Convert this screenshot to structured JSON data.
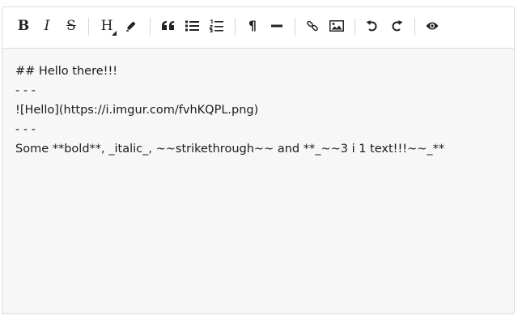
{
  "toolbar": {
    "buttons": [
      {
        "name": "bold-button",
        "icon": "bold-icon",
        "glyph": "B"
      },
      {
        "name": "italic-button",
        "icon": "italic-icon",
        "glyph": "I"
      },
      {
        "name": "strikethrough-button",
        "icon": "strikethrough-icon",
        "glyph": "S"
      },
      {
        "name": "heading-button",
        "icon": "heading-icon",
        "glyph": "H"
      },
      {
        "name": "highlight-button",
        "icon": "pen-icon"
      },
      {
        "name": "quote-button",
        "icon": "quote-icon"
      },
      {
        "name": "unordered-list-button",
        "icon": "bullet-list-icon"
      },
      {
        "name": "ordered-list-button",
        "icon": "numbered-list-icon"
      },
      {
        "name": "paragraph-button",
        "icon": "pilcrow-icon",
        "glyph": "¶"
      },
      {
        "name": "horizontal-rule-button",
        "icon": "horizontal-rule-icon"
      },
      {
        "name": "link-button",
        "icon": "link-icon"
      },
      {
        "name": "image-button",
        "icon": "image-icon"
      },
      {
        "name": "undo-button",
        "icon": "undo-icon"
      },
      {
        "name": "redo-button",
        "icon": "redo-icon"
      },
      {
        "name": "preview-button",
        "icon": "eye-icon"
      }
    ]
  },
  "editor": {
    "lines": [
      "## Hello there!!!",
      "- - -",
      "![Hello](https://i.imgur.com/fvhKQPL.png)",
      "- - -",
      "Some **bold**, _italic_, ~~strikethrough~~ and **_~~3 i 1 text!!!~~_**"
    ]
  },
  "colors": {
    "toolbar_bg": "#ffffff",
    "editor_bg": "#f7f7f7",
    "border": "#dcdcdc",
    "icon": "#222222"
  }
}
